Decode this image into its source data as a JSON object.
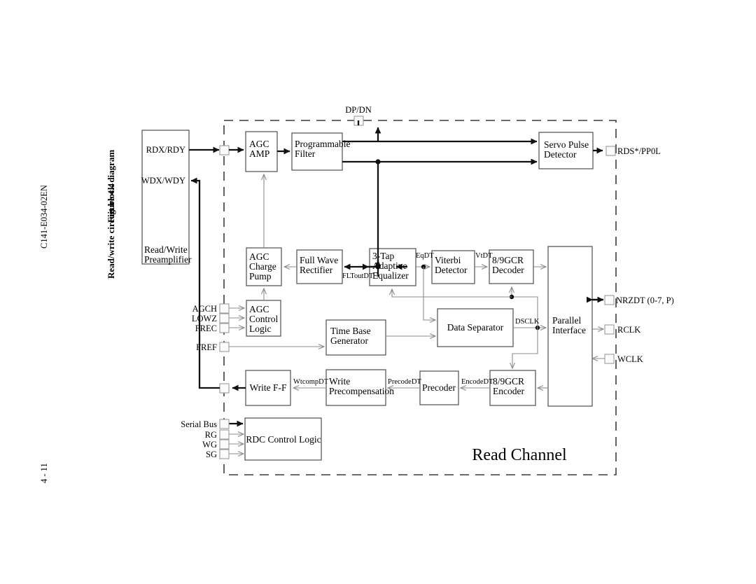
{
  "document": {
    "doc_id": "C141-E034-02EN",
    "page_number": "4 - 11",
    "figure_number": "Figure 4.4",
    "figure_caption": "Read/write circuit block diagram"
  },
  "region_label": "Read  Channel",
  "blocks": {
    "preamp": "Read/Write\nPreamplifier",
    "preamp_line1": "Read/Write",
    "preamp_line2": "Preamplifier",
    "agc_amp_l1": "AGC",
    "agc_amp_l2": "AMP",
    "prog_filter_l1": "Programmable",
    "prog_filter_l2": "Filter",
    "servo_pulse_l1": "Servo Pulse",
    "servo_pulse_l2": "Detector",
    "agc_charge_l1": "AGC",
    "agc_charge_l2": "Charge",
    "agc_charge_l3": "Pump",
    "full_wave_l1": "Full Wave",
    "full_wave_l2": "Rectifier",
    "equalizer_l1": "3-Tap",
    "equalizer_l2": "Adaptive",
    "equalizer_l3": "Equalizer",
    "viterbi_l1": "Viterbi",
    "viterbi_l2": "Detector",
    "gcr_decoder_l1": "8/9GCR",
    "gcr_decoder_l2": "Decoder",
    "agc_control_l1": "AGC",
    "agc_control_l2": "Control",
    "agc_control_l3": "Logic",
    "time_base_l1": "Time Base",
    "time_base_l2": "Generator",
    "data_separator": "Data Separator",
    "parallel_if_l1": "Parallel",
    "parallel_if_l2": "Interface",
    "write_ff": "Write F-F",
    "write_precomp_l1": "Write",
    "write_precomp_l2": "Precompensation",
    "precoder": "Precoder",
    "gcr_encoder_l1": "8/9GCR",
    "gcr_encoder_l2": "Encoder",
    "rdc_control": "RDC Control Logic"
  },
  "pins": {
    "dp_dn": "DP/DN",
    "rdx_rdy": "RDX/RDY",
    "wdx_wdy": "WDX/WDY",
    "rds_pp0l": "RDS*/PP0L",
    "nrzdt": "NRZDT (0-7, P)",
    "rclk": "RCLK",
    "wclk": "WCLK",
    "agch": "AGCH",
    "lowz": "LOWZ",
    "frec": "FREC",
    "fref": "FREF",
    "serial_bus": "Serial Bus",
    "rg": "RG",
    "wg": "WG",
    "sg": "SG"
  },
  "signals": {
    "fltoutdt": "FLToutDT",
    "eqdt": "EqDT",
    "vtdt": "VtDT",
    "dsclk": "DSCLK",
    "wtcompdt": "WtcompDT",
    "precodedt": "PrecodeDT",
    "encodedt": "EncodeDT"
  },
  "colors": {
    "block_stroke": "#5a5a5a",
    "thin_wire": "#8c8c8c",
    "thick_wire": "#111111",
    "boundary": "#3a3a3a",
    "background": "#ffffff"
  }
}
